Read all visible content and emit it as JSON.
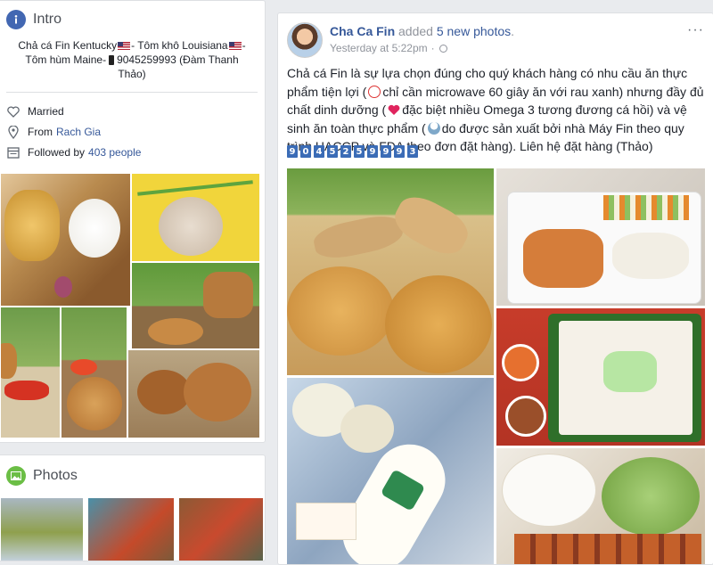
{
  "intro": {
    "title": "Intro",
    "bio_line1_a": "Chả cá Fin Kentucky",
    "bio_line1_b": "- Tôm khô Louisiana",
    "bio_line1_c": "-",
    "bio_line2_a": "Tôm hùm Maine-",
    "bio_line2_b": "9045259993 (Đàm Thanh",
    "bio_line3": "Thảo)",
    "relationship": "Married",
    "from_label": "From",
    "from_value": "Rach Gia",
    "followed_label": "Followed by",
    "followed_value": "403 people"
  },
  "photos": {
    "title": "Photos"
  },
  "post": {
    "author": "Cha Ca Fin",
    "action": " added ",
    "action_link": "5 new photos",
    "action_end": ".",
    "time": "Yesterday at 5:22pm",
    "menu": "···",
    "text_1": "Chả cá Fin là sự lựa chọn đúng cho quý khách hàng có nhu cầu ăn thực phẩm tiện lợi (",
    "text_2": "chỉ cần microwave 60 giây ăn với rau xanh) nhưng đầy đủ chất dinh dưỡng (",
    "text_3": "đặc biệt nhiều Omega 3 tương đương cá hồi) và vệ sinh ăn toàn thực phẩm (",
    "text_4": "do được sản xuất bởi nhà Máy Fin theo quy trình HACCP và FDA theo đơn đặt hàng). Liên hệ đặt hàng (Thảo)",
    "phone_digits": [
      "9",
      "0",
      "4",
      "5",
      "2",
      "5",
      "9",
      "9",
      "9",
      "3"
    ]
  },
  "colors": {
    "link": "#365899",
    "background": "#e9ebee",
    "digit_badge": "#3b6cb6"
  },
  "icons": [
    "info-icon",
    "heart-icon",
    "location-pin-icon",
    "follow-icon",
    "photos-icon",
    "globe-icon",
    "clock-icon",
    "heart-emoji-icon",
    "chef-icon"
  ]
}
